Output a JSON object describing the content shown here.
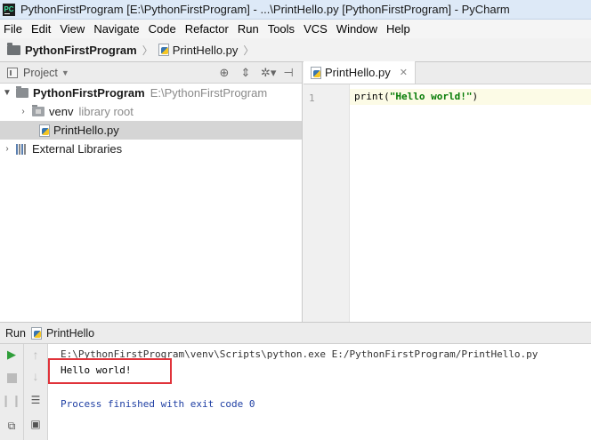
{
  "window": {
    "title": "PythonFirstProgram [E:\\PythonFirstProgram] - ...\\PrintHello.py [PythonFirstProgram] - PyCharm"
  },
  "menu": {
    "items": [
      "File",
      "Edit",
      "View",
      "Navigate",
      "Code",
      "Refactor",
      "Run",
      "Tools",
      "VCS",
      "Window",
      "Help"
    ]
  },
  "breadcrumb": {
    "project": "PythonFirstProgram",
    "file": "PrintHello.py"
  },
  "project_panel": {
    "title": "Project",
    "tree": {
      "root_name": "PythonFirstProgram",
      "root_path": "E:\\PythonFirstProgram",
      "venv_name": "venv",
      "venv_note": "library root",
      "file_name": "PrintHello.py",
      "external": "External Libraries"
    }
  },
  "editor": {
    "tab_label": "PrintHello.py",
    "line_number": "1",
    "code_prefix": "print(",
    "code_string": "\"Hello world!\"",
    "code_suffix": ")"
  },
  "run": {
    "label": "Run",
    "config_name": "PrintHello",
    "console": {
      "command": "E:\\PythonFirstProgram\\venv\\Scripts\\python.exe E:/PythonFirstProgram/PrintHello.py",
      "output": "Hello world!",
      "finish": "Process finished with exit code 0"
    }
  },
  "colors": {
    "highlight_border": "#e0333a",
    "string_green": "#057b05",
    "exit_blue": "#1f3fa3"
  }
}
